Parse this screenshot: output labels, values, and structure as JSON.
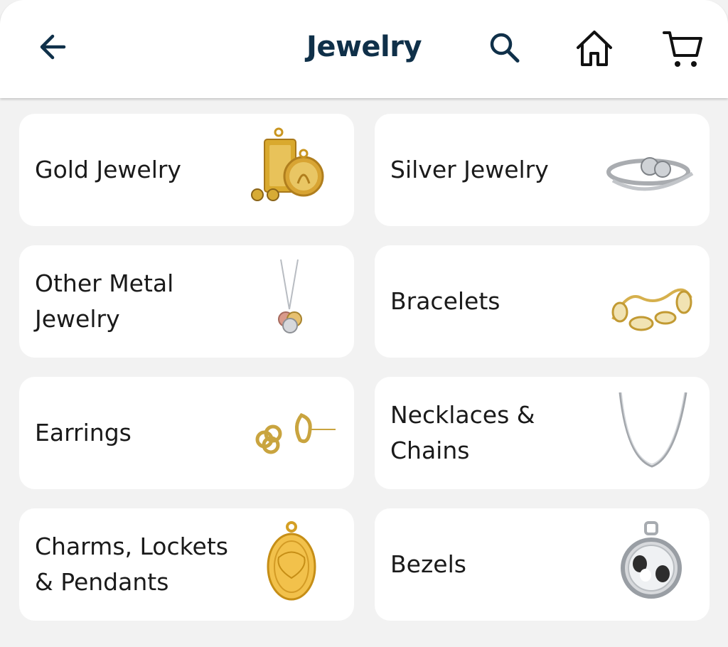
{
  "header": {
    "title": "Jewelry",
    "back_icon": "arrow-left-icon",
    "search_icon": "search-icon",
    "home_icon": "home-icon",
    "cart_icon": "cart-icon",
    "title_color": "#0f3049"
  },
  "categories": [
    {
      "label": "Gold Jewelry",
      "image": "gold-jewelry-image"
    },
    {
      "label": "Silver Jewelry",
      "image": "silver-jewelry-image"
    },
    {
      "label": "Other Metal\nJewelry",
      "image": "other-metal-jewelry-image"
    },
    {
      "label": "Bracelets",
      "image": "bracelets-image"
    },
    {
      "label": "Earrings",
      "image": "earrings-image"
    },
    {
      "label": "Necklaces &\nChains",
      "image": "necklaces-chains-image"
    },
    {
      "label": "Charms, Lockets\n& Pendants",
      "image": "charms-lockets-pendants-image"
    },
    {
      "label": "Bezels",
      "image": "bezels-image"
    }
  ]
}
